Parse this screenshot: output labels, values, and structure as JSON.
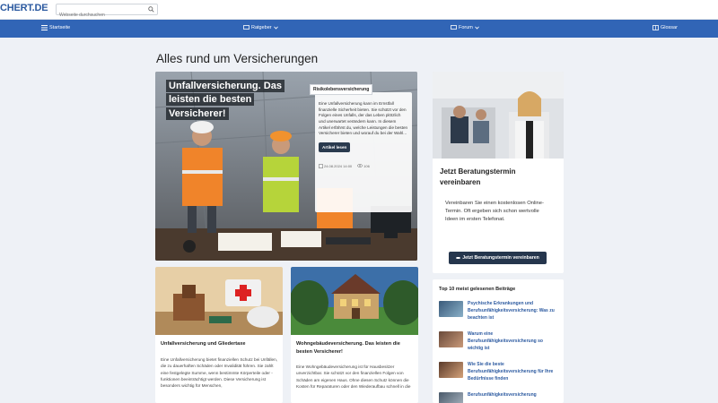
{
  "header": {
    "logo": "CHERT.DE",
    "search_placeholder": "Webseite durchsuchen"
  },
  "nav": {
    "items": [
      {
        "label": "Startseite",
        "icon": "list-icon"
      },
      {
        "label": "Ratgeber",
        "icon": "chat-icon",
        "has_dropdown": true
      },
      {
        "label": "Forum",
        "icon": "chat-icon",
        "has_dropdown": true
      },
      {
        "label": "Glossar",
        "icon": "book-icon"
      }
    ]
  },
  "main": {
    "title": "Alles rund um Versicherungen",
    "hero": {
      "title": "Unfallversicherung. Das leisten die besten Versicherer!",
      "tag": "Risikolebensversicherung",
      "text": "Eine Unfallversicherung kann im Ernstfall finanzielle Sicherheit bieten. Sie schützt vor den Folgen eines Unfalls, der das Leben plötzlich und unerwartet verändern kann. In diesem Artikel erfährst du, welche Leistungen die besten Versicherer bieten und worauf du bei der Wahl...",
      "button": "Artikel lesen",
      "date": "24.08.2024 14:00",
      "views": "106"
    },
    "cards": [
      {
        "title": "Unfallversicherung und Gliedertaxe",
        "text": "Eine Unfallversicherung bietet finanziellen Schutz bei Unfällen, die zu dauerhaften Schäden oder Invalidität führen. Sie zahlt eine festgelegte Summe, wenn bestimmte Körperteile oder -funktionen beeinträchtigt werden. Diese Versicherung ist besonders wichtig für Menschen,"
      },
      {
        "title": "Wohngebäudeversicherung. Das leisten die besten Versicherer!",
        "text": "Eine Wohngebäudeversicherung ist für Hausbesitzer unverzichtbar. Sie schützt vor den finanziellen Folgen von Schäden am eigenen Haus. Ohne diesen Schutz können die Kosten für Reparaturen oder den Wiederaufbau schnell in die"
      }
    ]
  },
  "sidebar": {
    "consult": {
      "title": "Jetzt Beratungstermin vereinbaren",
      "text": "Vereinbaren Sie einen kostenlosen Online-Termin. Oft ergeben sich schon wertvolle Ideen im ersten Telefonat.",
      "button": "Jetzt Beratungstermin vereinbaren"
    },
    "top10": {
      "title": "Top 10 meist gelesenen Beiträge",
      "items": [
        {
          "label": "Psychische Erkrankungen und Berufsunfähigkeitsversicherung: Was zu beachten ist"
        },
        {
          "label": "Warum eine Berufsunfähigkeitsversicherung so wichtig ist"
        },
        {
          "label": "Wie Sie die beste Berufsunfähigkeitsversicherung für Ihre Bedürfnisse finden"
        },
        {
          "label": "Berufsunfähigkeitsversicherung"
        }
      ]
    }
  },
  "colors": {
    "nav": "#3165b6",
    "link": "#2c5aa0",
    "button_dark": "#25364d",
    "page_bg": "#eef1f6"
  }
}
